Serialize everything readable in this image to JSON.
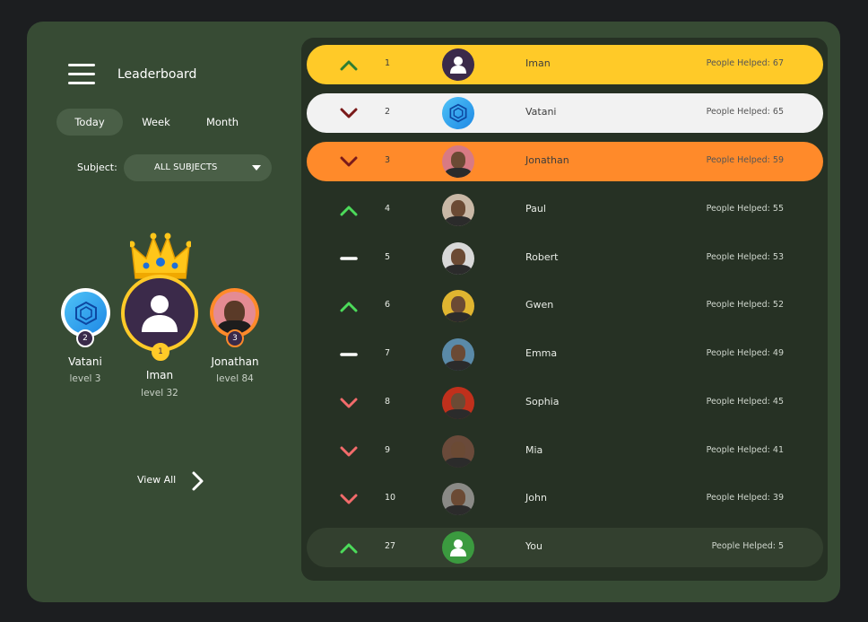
{
  "header": {
    "title": "Leaderboard"
  },
  "tabs": [
    {
      "label": "Today",
      "active": true
    },
    {
      "label": "Week",
      "active": false
    },
    {
      "label": "Month",
      "active": false
    }
  ],
  "subject": {
    "label": "Subject:",
    "value": "ALL SUBJECTS"
  },
  "podium": {
    "first": {
      "name": "Iman",
      "level": "level 32",
      "rank": "1"
    },
    "second": {
      "name": "Vatani",
      "level": "level 3",
      "rank": "2"
    },
    "third": {
      "name": "Jonathan",
      "level": "level 84",
      "rank": "3"
    }
  },
  "view_all": {
    "label": "View All"
  },
  "leaderboard": [
    {
      "rank": "1",
      "name": "Iman",
      "helped": "People Helped: 67",
      "trend": "up",
      "avatar": "user-icon",
      "bg": "#ffca28",
      "avatar_color": "#3b2a4a",
      "text": "#3d3d3d",
      "arrow": "#2e7d32"
    },
    {
      "rank": "2",
      "name": "Vatani",
      "helped": "People Helped: 65",
      "trend": "down",
      "avatar": "hexagon-logo",
      "bg": "#f2f2f2",
      "avatar_color": "#2196f3",
      "text": "#3d3d3d",
      "arrow": "#7a1a1a"
    },
    {
      "rank": "3",
      "name": "Jonathan",
      "helped": "People Helped: 59",
      "trend": "down",
      "avatar": "photo",
      "bg": "#ff8a2a",
      "avatar_color": "#d87a84",
      "text": "#3d3d3d",
      "arrow": "#7a1a1a"
    },
    {
      "rank": "4",
      "name": "Paul",
      "helped": "People Helped: 55",
      "trend": "up",
      "avatar": "photo",
      "bg": "transparent",
      "avatar_color": "#c9b8a6",
      "text": "#e8ece6",
      "arrow": "#4cdb5a"
    },
    {
      "rank": "5",
      "name": "Robert",
      "helped": "People Helped: 53",
      "trend": "same",
      "avatar": "photo",
      "bg": "transparent",
      "avatar_color": "#d8d8d8",
      "text": "#e8ece6",
      "arrow": "#ffffff"
    },
    {
      "rank": "6",
      "name": "Gwen",
      "helped": "People Helped: 52",
      "trend": "up",
      "avatar": "photo",
      "bg": "transparent",
      "avatar_color": "#e0b530",
      "text": "#e8ece6",
      "arrow": "#4cdb5a"
    },
    {
      "rank": "7",
      "name": "Emma",
      "helped": "People Helped: 49",
      "trend": "same",
      "avatar": "photo",
      "bg": "transparent",
      "avatar_color": "#5a8aa8",
      "text": "#e8ece6",
      "arrow": "#ffffff"
    },
    {
      "rank": "8",
      "name": "Sophia",
      "helped": "People Helped: 45",
      "trend": "down",
      "avatar": "photo",
      "bg": "transparent",
      "avatar_color": "#c0301c",
      "text": "#e8ece6",
      "arrow": "#f26b6b"
    },
    {
      "rank": "9",
      "name": "Mia",
      "helped": "People Helped: 41",
      "trend": "down",
      "avatar": "photo",
      "bg": "transparent",
      "avatar_color": "#6a4a3a",
      "text": "#e8ece6",
      "arrow": "#f26b6b"
    },
    {
      "rank": "10",
      "name": "John",
      "helped": "People Helped: 39",
      "trend": "down",
      "avatar": "photo",
      "bg": "transparent",
      "avatar_color": "#8a8a86",
      "text": "#e8ece6",
      "arrow": "#f26b6b"
    },
    {
      "rank": "27",
      "name": "You",
      "helped": "People Helped: 5",
      "trend": "up",
      "avatar": "user-icon",
      "bg": "#33402f",
      "avatar_color": "#3b9a3f",
      "text": "#e8ece6",
      "arrow": "#4cdb5a"
    }
  ],
  "colors": {
    "background": "#1c1e20",
    "card": "#374b34",
    "board": "#263124",
    "gold": "#ffca28"
  }
}
